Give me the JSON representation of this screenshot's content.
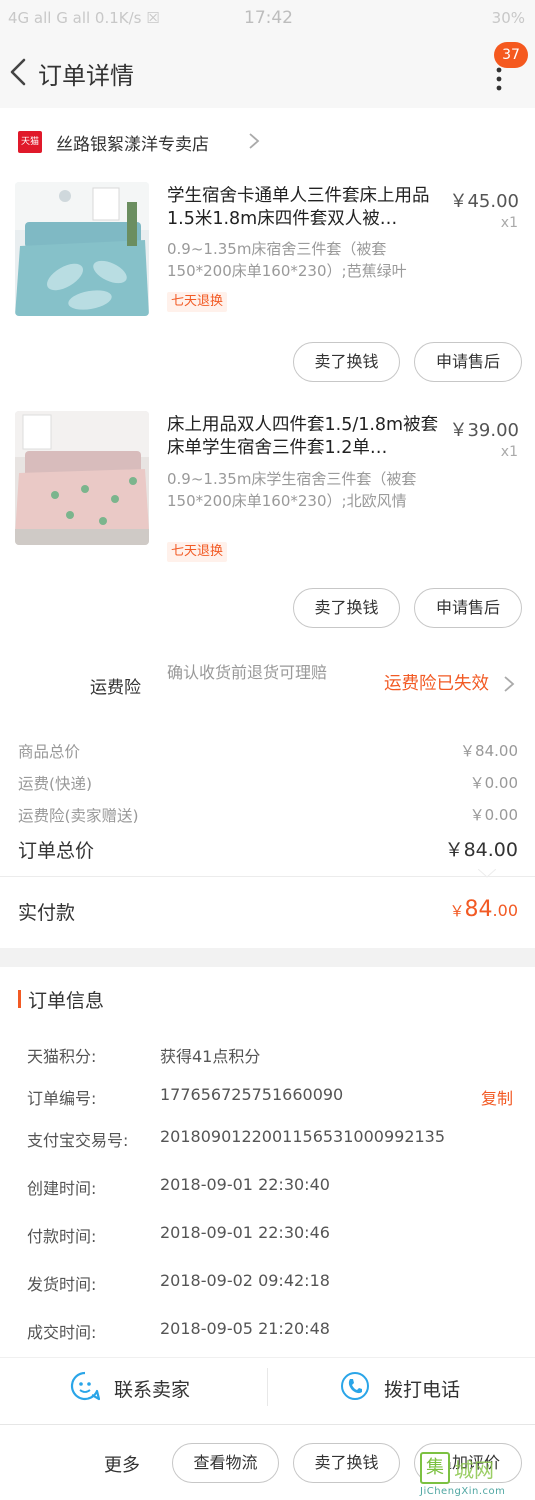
{
  "status_bar": {
    "left": "4G all G all 0.1K/s ☒",
    "time": "17:42",
    "right": "30%"
  },
  "header": {
    "title": "订单详情",
    "badge": "37"
  },
  "shop": {
    "logo": "天猫",
    "name": "丝路银絮漾洋专卖店"
  },
  "products": [
    {
      "title": "学生宿舍卡通单人三件套床上用品1.5米1.8m床四件套双人被…",
      "sku": "0.9~1.35m床宿舍三件套（被套150*200床单160*230）;芭蕉绿叶",
      "tag": "七天退换",
      "price": "￥45.00",
      "qty": "x1",
      "buttons": [
        "卖了换钱",
        "申请售后"
      ]
    },
    {
      "title": "床上用品双人四件套1.5/1.8m被套床单学生宿舍三件套1.2单…",
      "sku": "0.9~1.35m床学生宿舍三件套（被套150*200床单160*230）;北欧风情",
      "tag": "七天退换",
      "price": "￥39.00",
      "qty": "x1",
      "buttons": [
        "卖了换钱",
        "申请售后"
      ]
    }
  ],
  "insurance": {
    "label": "运费险",
    "desc": "确认收货前退货可理赔",
    "status": "运费险已失效"
  },
  "summary": {
    "rows": [
      {
        "label": "商品总价",
        "value": "￥84.00"
      },
      {
        "label": "运费(快递)",
        "value": "￥0.00"
      },
      {
        "label": "运费险(卖家赠送)",
        "value": "￥0.00"
      }
    ],
    "total_label": "订单总价",
    "total_value": "￥84.00",
    "paid_label": "实付款",
    "paid_currency": "￥",
    "paid_int": "84",
    "paid_dec": ".00"
  },
  "order_info": {
    "title": "订单信息",
    "rows": [
      {
        "key": "天猫积分:",
        "value": "获得41点积分"
      },
      {
        "key": "订单编号:",
        "value": "177656725751660090",
        "action": "复制"
      },
      {
        "key": "支付宝交易号:",
        "value": "2018090122001156531000992135"
      },
      {
        "key": "创建时间:",
        "value": "2018-09-01 22:30:40"
      },
      {
        "key": "付款时间:",
        "value": "2018-09-01 22:30:46"
      },
      {
        "key": "发货时间:",
        "value": "2018-09-02 09:42:18"
      },
      {
        "key": "成交时间:",
        "value": "2018-09-05 21:20:48"
      }
    ]
  },
  "contact": {
    "seller": "联系卖家",
    "phone": "拨打电话"
  },
  "bottom_bar": {
    "more": "更多",
    "buttons": [
      "查看物流",
      "卖了换钱",
      "追加评价"
    ]
  },
  "watermark": {
    "logo": "集",
    "text": "城网",
    "url": "JiChengXin.com"
  },
  "colors": {
    "accent": "#f25a24",
    "badge": "#f5591f",
    "tmall_red": "#e0192a",
    "contact_blue": "#2aa5e8"
  }
}
